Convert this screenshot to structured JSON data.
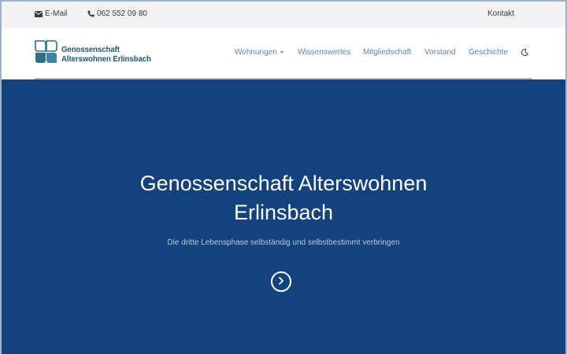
{
  "topbar": {
    "email_label": "E-Mail",
    "phone_label": "062 552 09 80",
    "contact_label": "Kontakt"
  },
  "logo": {
    "line1": "Genossenschaft",
    "line2": "Alterswohnen Erlinsbach"
  },
  "nav": {
    "items": [
      {
        "label": "Wohnungen"
      },
      {
        "label": "Wissenswertes"
      },
      {
        "label": "Mitgliedschaft"
      },
      {
        "label": "Vorstand"
      },
      {
        "label": "Geschichte"
      }
    ],
    "theme_toggle_icon": "moon-icon"
  },
  "hero": {
    "title_line1": "Genossenschaft Alterswohnen",
    "title_line2": "Erlinsbach",
    "subtitle": "Die dritte Lebensphase selbständig und selbstbestimmt verbringen",
    "next_icon": "chevron-right-icon"
  },
  "colors": {
    "hero_bg": "#13427d",
    "nav_link": "#5f85a6",
    "logo_text": "#1f5677",
    "topbar_bg": "#f2f2f4"
  }
}
